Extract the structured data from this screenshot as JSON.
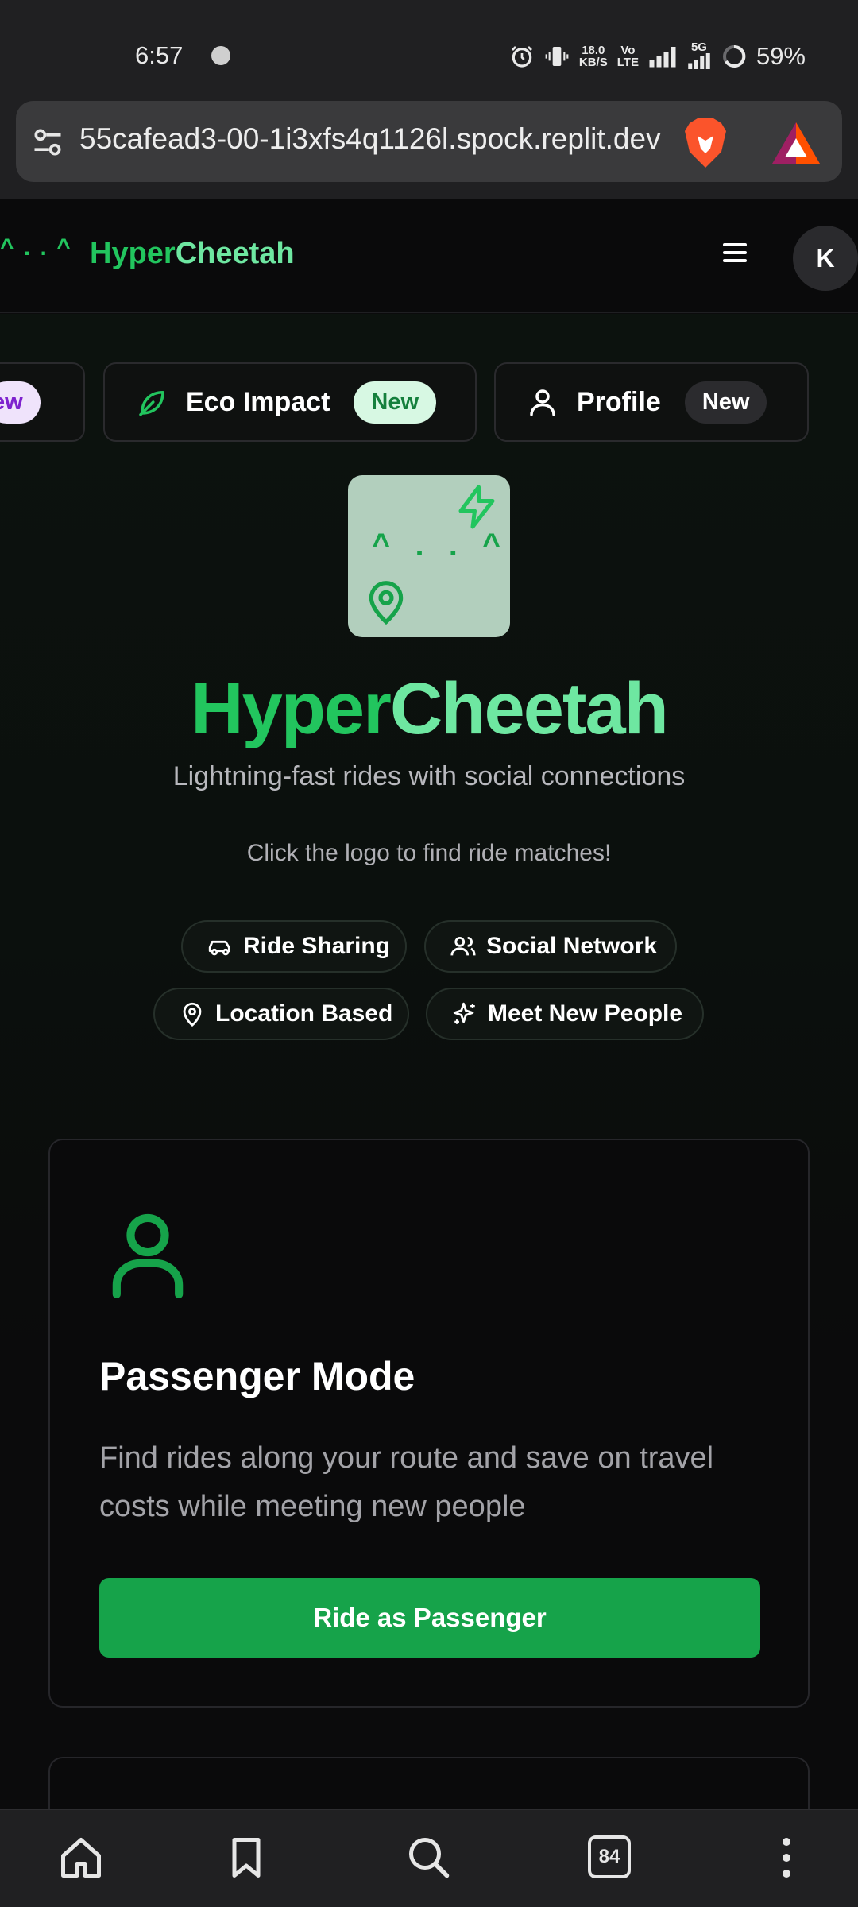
{
  "status_bar": {
    "time": "6:57",
    "net_speed_value": "18.0",
    "net_speed_unit": "KB/S",
    "volte_top": "Vo",
    "volte_bottom": "LTE",
    "signal_gen": "5G",
    "battery": "59%"
  },
  "browser": {
    "url": "55cafead3-00-1i3xfs4q1126l.spock.replit.dev",
    "tab_count": "84"
  },
  "header": {
    "logo_face": "^ . . ^",
    "brand_first": "Hyper",
    "brand_second": "Cheetah",
    "avatar_initial": "K"
  },
  "tabs": [
    {
      "label": "",
      "badge": "ew"
    },
    {
      "label": "Eco Impact",
      "badge": "New"
    },
    {
      "label": "Profile",
      "badge": "New"
    }
  ],
  "hero": {
    "logo_face": "^ . . ^",
    "title_first": "Hyper",
    "title_second": "Cheetah",
    "subtitle": "Lightning-fast rides with social connections",
    "hint": "Click the logo to find ride matches!"
  },
  "features": [
    {
      "label": "Ride Sharing",
      "icon": "car-icon"
    },
    {
      "label": "Social Network",
      "icon": "users-icon"
    },
    {
      "label": "Location Based",
      "icon": "map-pin-icon"
    },
    {
      "label": "Meet New People",
      "icon": "sparkles-icon"
    }
  ],
  "passenger_card": {
    "title": "Passenger Mode",
    "description": "Find rides along your route and save on travel costs while meeting new people",
    "button": "Ride as Passenger"
  },
  "colors": {
    "accent": "#22c55e",
    "accent_light": "#6ee7a1",
    "button": "#16a34a",
    "background": "#0b0b0c"
  }
}
